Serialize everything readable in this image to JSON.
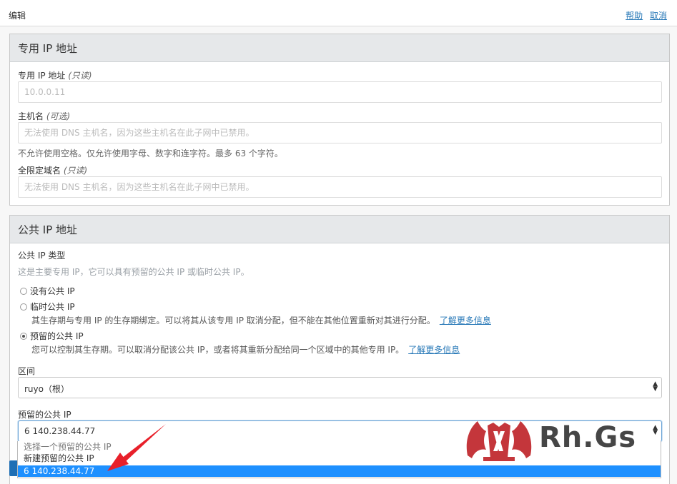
{
  "topbar": {
    "title": "编辑",
    "help": "帮助",
    "cancel": "取消"
  },
  "private_ip": {
    "heading": "专用 IP 地址",
    "address_label": "专用 IP 地址",
    "address_hint": "(只读)",
    "address_value": "10.0.0.11",
    "hostname_label": "主机名",
    "hostname_hint": "(可选)",
    "hostname_placeholder": "无法使用 DNS 主机名，因为这些主机名在此子网中已禁用。",
    "hostname_help": "不允许使用空格。仅允许使用字母、数字和连字符。最多 63 个字符。",
    "fqdn_label": "全限定域名",
    "fqdn_hint": "(只读)",
    "fqdn_placeholder": "无法使用 DNS 主机名，因为这些主机名在此子网中已禁用。"
  },
  "public_ip": {
    "heading": "公共 IP 地址",
    "type_label": "公共 IP 类型",
    "type_help": "这是主要专用 IP，它可以具有预留的公共 IP 或临时公共 IP。",
    "options": [
      {
        "label": "没有公共 IP",
        "checked": false
      },
      {
        "label": "临时公共 IP",
        "checked": false,
        "desc": "其生存期与专用 IP 的生存期绑定。可以将其从该专用 IP 取消分配，但不能在其他位置重新对其进行分配。",
        "link": "了解更多信息"
      },
      {
        "label": "预留的公共 IP",
        "checked": true,
        "desc": "您可以控制其生存期。可以取消分配该公共 IP，或者将其重新分配给同一个区域中的其他专用 IP。",
        "link": "了解更多信息"
      }
    ],
    "compartment_label": "区间",
    "compartment_value": "ruyo（根）",
    "reserved_label": "预留的公共 IP",
    "reserved_value": "6 140.238.44.77",
    "dropdown_options": [
      "选择一个预留的公共 IP",
      "新建预留的公共 IP",
      "6 140.238.44.77"
    ]
  },
  "watermark": {
    "text": "Rh.Gs"
  },
  "colors": {
    "link": "#2a7ab8",
    "selected_option": "#1e90ff",
    "arrow": "#e8202a",
    "panel_header": "#e6e8ea"
  }
}
